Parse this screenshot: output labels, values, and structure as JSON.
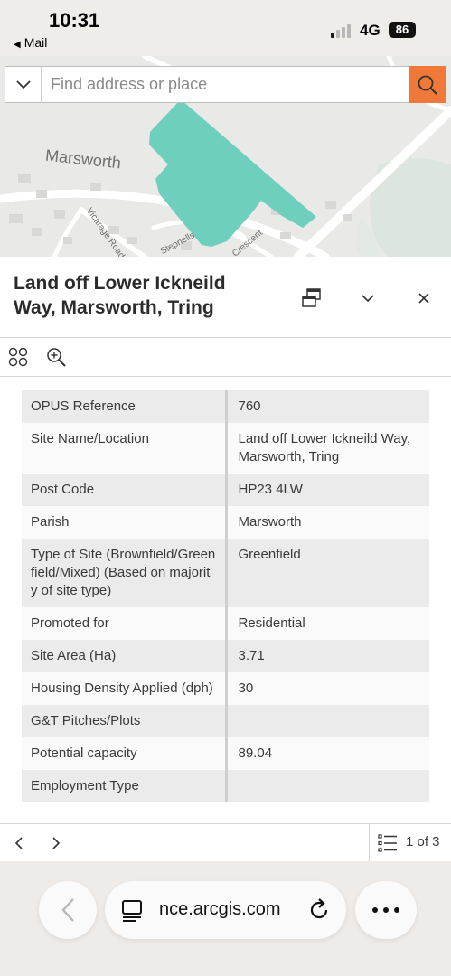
{
  "status_bar": {
    "time": "10:31",
    "back_app": "Mail",
    "network": "4G",
    "battery": "86"
  },
  "map": {
    "labels": {
      "town": "Marsworth",
      "road1": "Vicarage Road",
      "road2": "Stepnells",
      "road3": "Crescent"
    },
    "highlight_color": "#6fcfbd"
  },
  "search": {
    "placeholder": "Find address or place",
    "accent_color": "#f0793a"
  },
  "feature": {
    "title": "Land off Lower Ickneild Way, Marsworth, Tring",
    "rows": [
      {
        "key": "OPUS Reference",
        "value": "760"
      },
      {
        "key": "Site Name/Location",
        "value": "Land off Lower Ickneild Way, Marsworth, Tring"
      },
      {
        "key": "Post Code",
        "value": "HP23 4LW"
      },
      {
        "key": "Parish",
        "value": "Marsworth"
      },
      {
        "key": "Type of Site (Brownfield/Greenfield/Mixed) (Based on majority of site type)",
        "value": "Greenfield"
      },
      {
        "key": "Promoted for",
        "value": "Residential"
      },
      {
        "key": "Site Area (Ha)",
        "value": "3.71"
      },
      {
        "key": "Housing Density Applied (dph)",
        "value": "30"
      },
      {
        "key": "G&T Pitches/Plots",
        "value": ""
      },
      {
        "key": "Potential capacity",
        "value": "89.04"
      },
      {
        "key": "Employment Type",
        "value": ""
      }
    ]
  },
  "pager": {
    "count": "1 of 3"
  },
  "browser": {
    "url": "nce.arcgis.com"
  }
}
